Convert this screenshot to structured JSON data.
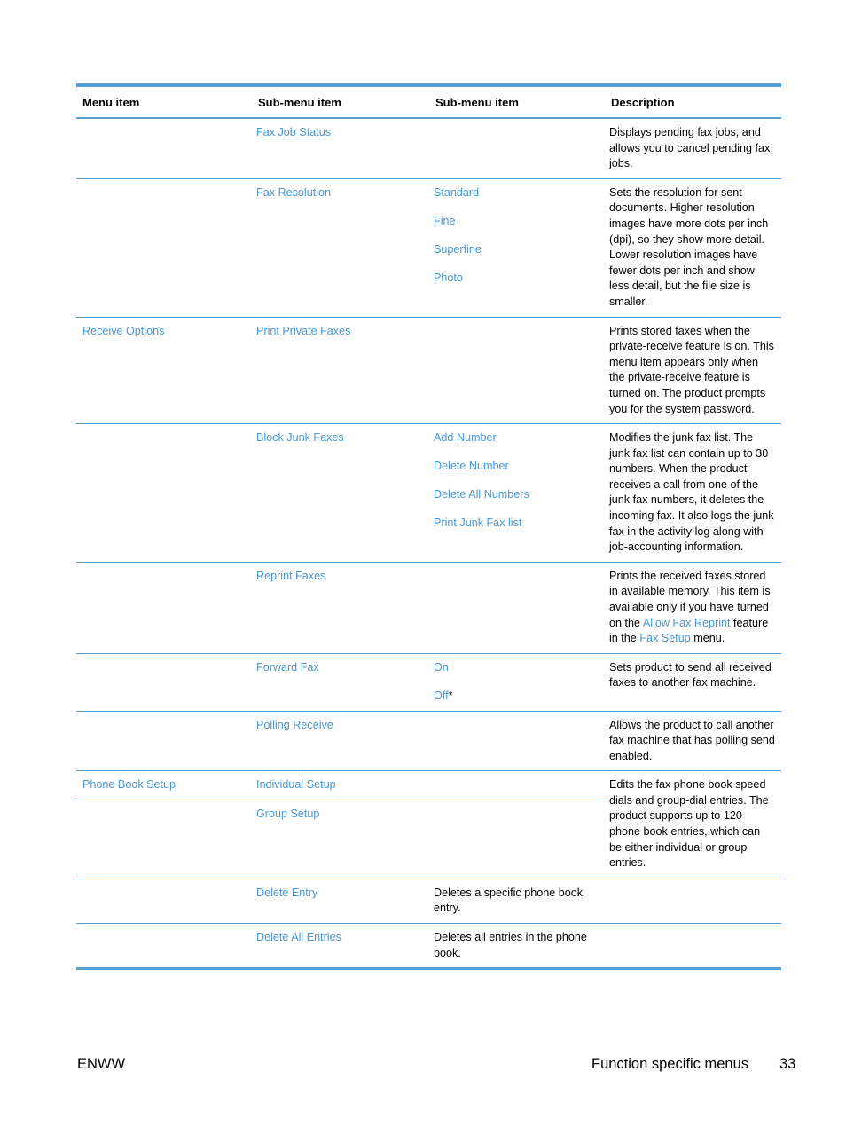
{
  "table": {
    "headers": [
      "Menu item",
      "Sub-menu item",
      "Sub-menu item",
      "Description"
    ],
    "rows": [
      {
        "menu": "",
        "sub1": "Fax Job Status",
        "sub2": [],
        "description": "Displays pending fax jobs, and allows you to cancel pending fax jobs."
      },
      {
        "menu": "",
        "sub1": "Fax Resolution",
        "sub2": [
          "Standard",
          "Fine",
          "Superfine",
          "Photo"
        ],
        "description": "Sets the resolution for sent documents. Higher resolution images have more dots per inch (dpi), so they show more detail. Lower resolution images have fewer dots per inch and show less detail, but the file size is smaller."
      },
      {
        "menu": "Receive Options",
        "sub1": "Print Private Faxes",
        "sub2": [],
        "description": "Prints stored faxes when the private-receive feature is on. This menu item appears only when the private-receive feature is turned on. The product prompts you for the system password."
      },
      {
        "menu": "",
        "sub1": "Block Junk Faxes",
        "sub2": [
          "Add Number",
          "Delete Number",
          "Delete All Numbers",
          "Print Junk Fax list"
        ],
        "description": "Modifies the junk fax list. The junk fax list can contain up to 30 numbers. When the product receives a call from one of the junk fax numbers, it deletes the incoming fax. It also logs the junk fax in the activity log along with job-accounting information."
      },
      {
        "menu": "",
        "sub1": "Reprint Faxes",
        "sub2": [],
        "description_parts": [
          {
            "text": "Prints the received faxes stored in available memory. This item is available only if you have turned on the ",
            "link": false
          },
          {
            "text": "Allow Fax Reprint",
            "link": true
          },
          {
            "text": " feature in the ",
            "link": false
          },
          {
            "text": "Fax Setup",
            "link": true
          },
          {
            "text": " menu.",
            "link": false
          }
        ]
      },
      {
        "menu": "",
        "sub1": "Forward Fax",
        "sub2": [
          "On",
          "Off"
        ],
        "sub2_default_marker": "*",
        "description": "Sets product to send all received faxes to another fax machine."
      },
      {
        "menu": "",
        "sub1": "Polling Receive",
        "sub2": [],
        "description": "Allows the product to call another fax machine that has polling send enabled."
      },
      {
        "menu": "Phone Book Setup",
        "sub1": "Individual Setup",
        "sub1b": "Group Setup",
        "description": "Edits the fax phone book speed dials and group-dial entries. The product supports up to 120 phone book entries, which can be either individual or group entries."
      },
      {
        "menu": "",
        "sub1": "Delete Entry",
        "sub2_text": "Deletes a specific phone book entry."
      },
      {
        "menu": "",
        "sub1": "Delete All Entries",
        "sub2_text": "Deletes all entries in the phone book."
      }
    ]
  },
  "footer": {
    "left": "ENWW",
    "section_title": "Function specific menus",
    "page_number": "33"
  },
  "colors": {
    "accent": "#5a9fd4",
    "link": "#4a97d2",
    "text": "#000000"
  }
}
